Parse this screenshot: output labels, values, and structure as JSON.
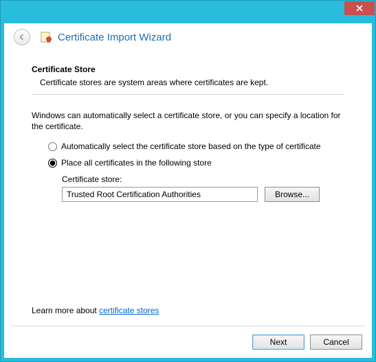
{
  "header": {
    "title": "Certificate Import Wizard"
  },
  "section": {
    "title": "Certificate Store",
    "subtitle": "Certificate stores are system areas where certificates are kept.",
    "description": "Windows can automatically select a certificate store, or you can specify a location for the certificate."
  },
  "options": {
    "auto": "Automatically select the certificate store based on the type of certificate",
    "place": "Place all certificates in the following store"
  },
  "store": {
    "label": "Certificate store:",
    "value": "Trusted Root Certification Authorities",
    "browse": "Browse..."
  },
  "learn": {
    "prefix": "Learn more about ",
    "link": "certificate stores"
  },
  "footer": {
    "next": "Next",
    "cancel": "Cancel"
  }
}
